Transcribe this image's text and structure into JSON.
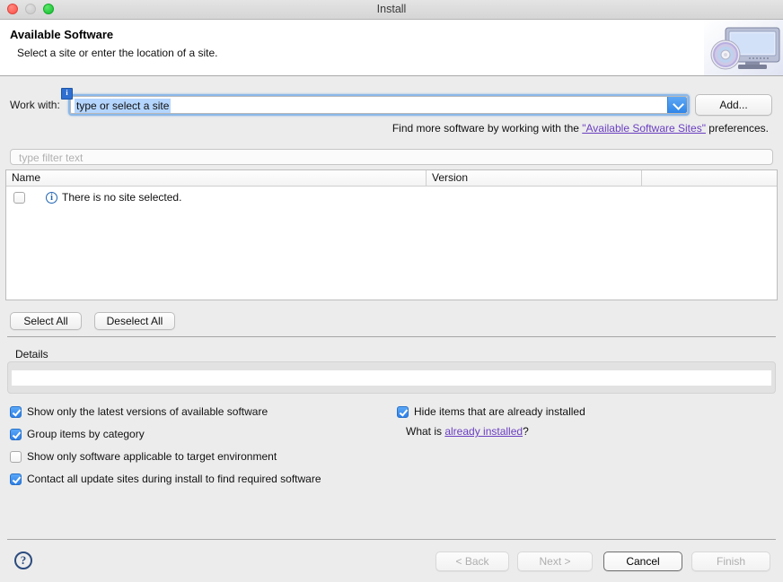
{
  "window": {
    "title": "Install",
    "controls": {
      "close": "close",
      "minimize": "minimize",
      "maximize": "maximize"
    }
  },
  "header": {
    "title": "Available Software",
    "subtitle": "Select a site or enter the location of a site.",
    "banner_icon": "install-computer-disc-icon"
  },
  "work_with": {
    "label": "Work with:",
    "value": "type or select a site",
    "decorator": "i",
    "dropdown_icon": "chevron-down-icon",
    "add_button": "Add..."
  },
  "find_more": {
    "prefix": "Find more software by working with the ",
    "link": "\"Available Software Sites\"",
    "suffix": " preferences."
  },
  "filter": {
    "placeholder": "type filter text",
    "value": ""
  },
  "table": {
    "columns": [
      "Name",
      "Version"
    ],
    "rows": [
      {
        "checked": false,
        "icon": "info-circle-icon",
        "name": "There is no site selected.",
        "version": ""
      }
    ]
  },
  "selection_buttons": {
    "select_all": "Select All",
    "deselect_all": "Deselect All"
  },
  "details": {
    "label": "Details",
    "text": ""
  },
  "options": {
    "left": [
      {
        "label": "Show only the latest versions of available software",
        "checked": true
      },
      {
        "label": "Group items by category",
        "checked": true
      },
      {
        "label": "Show only software applicable to target environment",
        "checked": false
      },
      {
        "label": "Contact all update sites during install to find required software",
        "checked": true
      }
    ],
    "right": [
      {
        "label": "Hide items that are already installed",
        "checked": true
      }
    ],
    "what_is": {
      "prefix": "What is ",
      "link": "already installed",
      "suffix": "?"
    }
  },
  "footer": {
    "help": "?",
    "back": "< Back",
    "next": "Next >",
    "cancel": "Cancel",
    "finish": "Finish"
  },
  "colors": {
    "accent": "#2d7fe8",
    "link": "#6a3fc0",
    "info": "#1d63b3",
    "window_bg": "#ececec"
  }
}
